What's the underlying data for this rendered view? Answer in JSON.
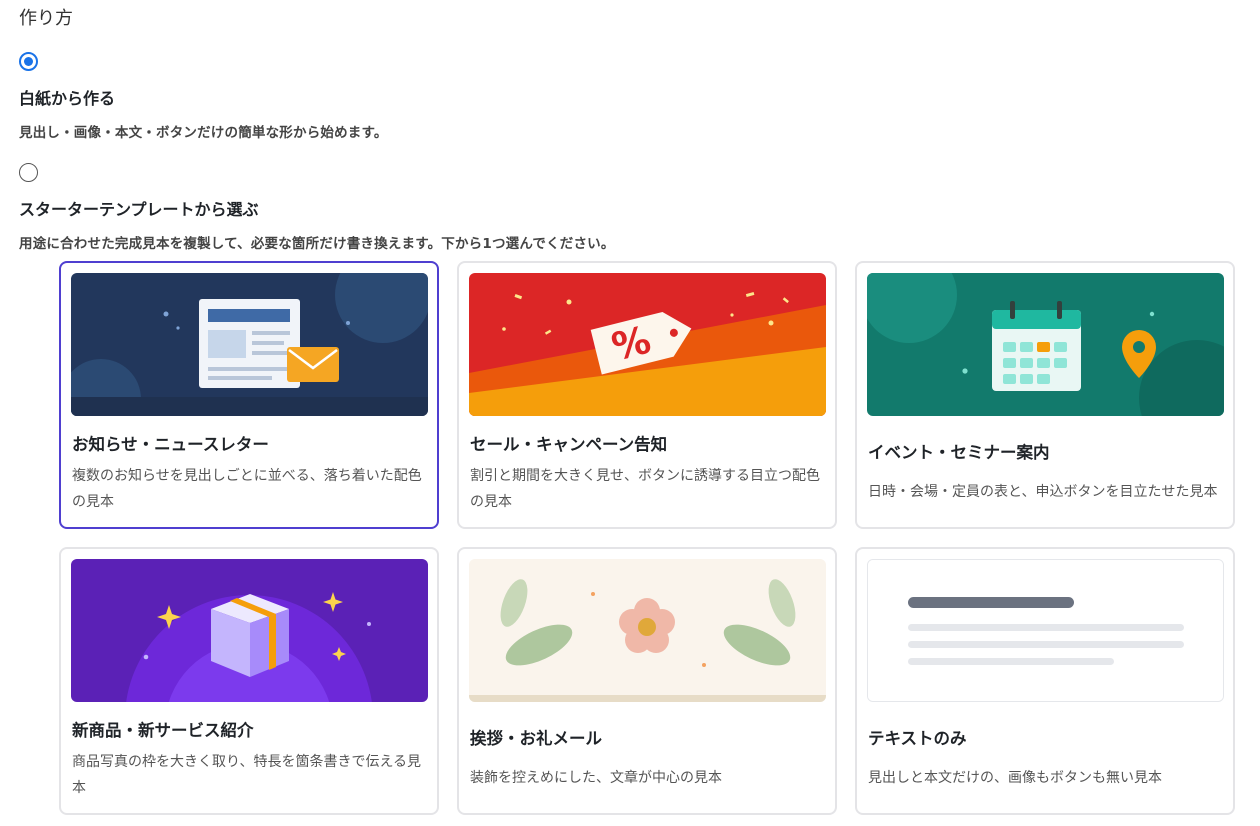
{
  "section": {
    "heading": "作り方"
  },
  "options": [
    {
      "title": "白紙から作る",
      "description": "見出し・画像・本文・ボタンだけの簡単な形から始めます。",
      "selected": true
    },
    {
      "title": "スターターテンプレートから選ぶ",
      "description": "用途に合わせた完成見本を複製して、必要な箇所だけ書き換えます。下から1つ選んでください。",
      "selected": false
    }
  ],
  "templates": [
    {
      "title": "お知らせ・ニュースレター",
      "description": "複数のお知らせを見出しごとに並べる、落ち着いた配色の見本",
      "icon": "newsletter-envelope-icon",
      "selected": true
    },
    {
      "title": "セール・キャンペーン告知",
      "description": "割引と期間を大きく見せ、ボタンに誘導する目立つ配色の見本",
      "icon": "percent-tag-icon",
      "selected": false
    },
    {
      "title": "イベント・セミナー案内",
      "description": "日時・会場・定員の表と、申込ボタンを目立たせた見本",
      "icon": "calendar-pin-icon",
      "selected": false
    },
    {
      "title": "新商品・新サービス紹介",
      "description": "商品写真の枠を大きく取り、特長を箇条書きで伝える見本",
      "icon": "product-box-icon",
      "selected": false
    },
    {
      "title": "挨拶・お礼メール",
      "description": "装飾を控えめにした、文章が中心の見本",
      "icon": "flower-leaves-icon",
      "selected": false
    },
    {
      "title": "テキストのみ",
      "description": "見出しと本文だけの、画像もボタンも無い見本",
      "icon": "text-lines-icon",
      "selected": false
    }
  ],
  "colors": {
    "accent": "#1a73e8",
    "selected_border": "#4f3fd0",
    "card_border": "#e4e4e7"
  }
}
